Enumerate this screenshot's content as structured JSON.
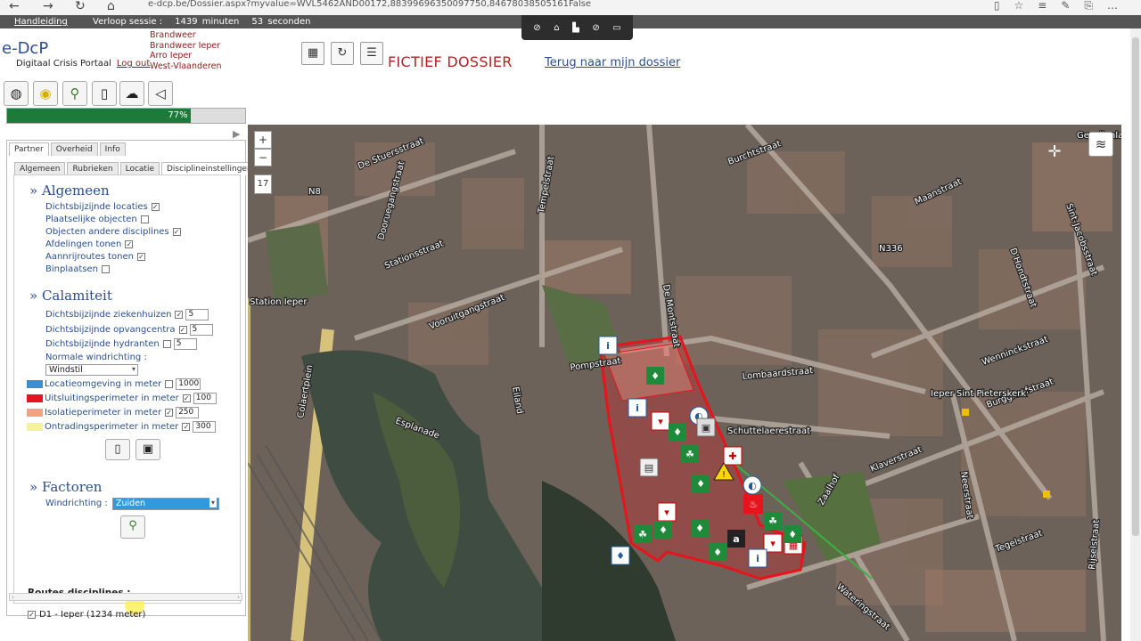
{
  "browser": {
    "url": "e-dcp.be/Dossier.aspx?myvalue=WVL5462AND00172,88399696350097750,84678038505161False"
  },
  "session": {
    "handleiding": "Handleiding",
    "label": "Verloop sessie :",
    "minutes": "1439",
    "minutes_unit": "minuten",
    "seconds": "53",
    "seconds_unit": "seconden"
  },
  "header": {
    "logo": "e-DcP",
    "subtitle": "Digitaal Crisis Portaal",
    "logout": "Log out",
    "orgs": [
      "Brandweer",
      "Brandweer Ieper",
      "Arro Ieper",
      "West-Vlaanderen"
    ],
    "dossier_title": "FICTIEF DOSSIER",
    "back_link": "Terug naar mijn dossier"
  },
  "progress": {
    "value": 0.77,
    "label": "77%"
  },
  "tabs_top": [
    "Partner",
    "Overheid",
    "Info"
  ],
  "tabs_inner": [
    "Algemeen",
    "Rubrieken",
    "Locatie",
    "Disciplineinstellingen"
  ],
  "algemeen": {
    "title": "Algemeen",
    "items": [
      {
        "label": "Dichtsbijzijnde locaties",
        "checked": true
      },
      {
        "label": "Plaatselijke objecten",
        "checked": false
      },
      {
        "label": "Objecten andere disciplines",
        "checked": true
      },
      {
        "label": "Afdelingen tonen",
        "checked": true
      },
      {
        "label": "Aannrijroutes tonen",
        "checked": true
      },
      {
        "label": "Binplaatsen",
        "checked": false
      }
    ]
  },
  "calamiteit": {
    "title": "Calamiteit",
    "items": [
      {
        "label": "Dichtsbijzijnde ziekenhuizen",
        "checked": true,
        "value": "5"
      },
      {
        "label": "Dichtsbijzijnde opvangcentra",
        "checked": true,
        "value": "5"
      },
      {
        "label": "Dichtsbijzijnde hydranten",
        "checked": false,
        "value": "5"
      }
    ],
    "wind_label": "Normale windrichting :",
    "wind_value": "Windstil",
    "perimeters": [
      {
        "label": "Locatieomgeving in meter",
        "checked": false,
        "value": "1000",
        "color": "#3a8fd0"
      },
      {
        "label": "Uitsluitingsperimeter in meter",
        "checked": true,
        "value": "100",
        "color": "#e8141b"
      },
      {
        "label": "Isolatieperimeter in meter",
        "checked": true,
        "value": "250",
        "color": "#f2a37a"
      },
      {
        "label": "Ontradingsperimeter in meter",
        "checked": true,
        "value": "300",
        "color": "#f5f29a"
      }
    ]
  },
  "factoren": {
    "title": "Factoren",
    "wind_label": "Windrichting :",
    "wind_value": "Zuiden"
  },
  "routes": {
    "title": "Routes disciplines :",
    "item": "D1 - Ieper (1234 meter)"
  },
  "map": {
    "zoom_in": "+",
    "zoom_out": "−",
    "zoom_level": "17",
    "streets": [
      "De Stuersstraat",
      "Dooruegangstraat",
      "Stationsstraat",
      "Vooruitgangstraat",
      "Tempelstraat",
      "Burchtstraat",
      "Maanstraat",
      "Gezellenlaan",
      "Sint-Jacobsstraat",
      "D'Hondtstraat",
      "De Montstraat",
      "Pompstraat",
      "Lombaardstraat",
      "Schuttelaerestraat",
      "Zaalhof",
      "Esplanade",
      "Eiland",
      "Colaertplein",
      "Klaverstraat",
      "Neerstraat",
      "Tegelstraat",
      "Wateringstraat",
      "Rijselstraat",
      "Wenninckstraat",
      "Burggraafstraat",
      "Station Ieper",
      "N8",
      "N336",
      "Ieper Sint Pieterskerk"
    ]
  }
}
